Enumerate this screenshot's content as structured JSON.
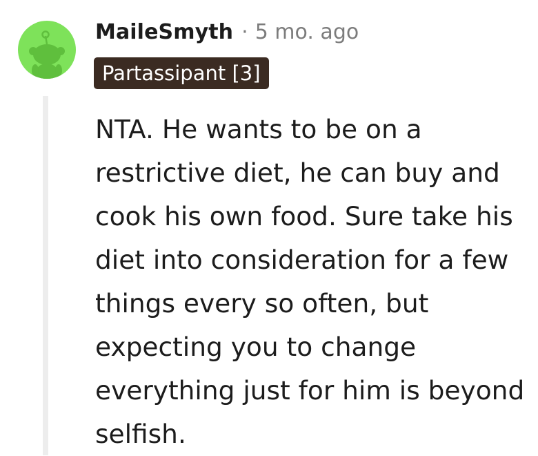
{
  "comment": {
    "username": "MaileSmyth",
    "separator": "·",
    "timestamp": "5 mo. ago",
    "flair": "Partassipant [3]",
    "body": "NTA. He wants to be on a restrictive diet, he can buy and cook his own food. Sure take his diet into consideration for a few things every so often, but expecting you to change everything just for him is beyond selfish."
  },
  "avatar": {
    "icon": "reddit-snoo-icon",
    "background_color": "#7ee25a",
    "figure_color": "#5fbf3d"
  },
  "colors": {
    "flair_background": "#3b2b22",
    "flair_text": "#ffffff",
    "meta_text": "#7c7c7c",
    "body_text": "#1c1c1c",
    "thread_line": "#ededed"
  }
}
